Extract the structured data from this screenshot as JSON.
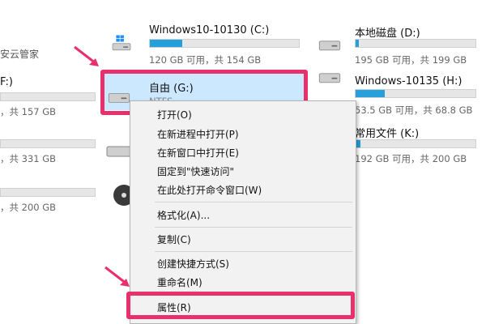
{
  "colors": {
    "accent": "#e8306c",
    "usage_bar": "#26a0da"
  },
  "top_left_label": "安云管家",
  "drives": [
    {
      "id": "c",
      "name": "Windows10-10130 (C:)",
      "space": "120 GB 可用，共 154 GB",
      "used_fraction": 0.22,
      "icon": "windows-drive-icon"
    },
    {
      "id": "d",
      "name": "本地磁盘 (D:)",
      "space": "195 GB 可用，共 199 GB",
      "used_fraction": 0.03,
      "icon": "hard-drive-icon"
    },
    {
      "id": "g",
      "name": "自由 (G:)",
      "space": "NTFS",
      "icon": "hard-drive-icon"
    },
    {
      "id": "h",
      "name": "Windows-10135 (H:)",
      "space": "53.5 GB 可用，共 68.8 GB",
      "used_fraction": 0.24,
      "icon": "hard-drive-icon"
    },
    {
      "id": "k",
      "name": "常用文件 (K:)",
      "space": "192 GB 可用，共 200 GB",
      "used_fraction": 0.04,
      "icon": "hard-drive-icon"
    }
  ],
  "left_partial": [
    {
      "name": "F:)",
      "space": "共 157 GB"
    },
    {
      "space": "共 331 GB"
    },
    {
      "space": "共 200 GB"
    }
  ],
  "context_menu": {
    "items": [
      {
        "id": "open",
        "label": "打开(O)"
      },
      {
        "id": "open-new-process",
        "label": "在新进程中打开(P)"
      },
      {
        "id": "open-new-window",
        "label": "在新窗口中打开(E)"
      },
      {
        "id": "pin-quick-access",
        "label": "固定到\"快速访问\""
      },
      {
        "id": "open-cmd-here",
        "label": "在此处打开命令窗口(W)"
      },
      {
        "id": "format",
        "label": "格式化(A)..."
      },
      {
        "id": "copy",
        "label": "复制(C)"
      },
      {
        "id": "create-shortcut",
        "label": "创建快捷方式(S)"
      },
      {
        "id": "rename",
        "label": "重命名(M)"
      },
      {
        "id": "properties",
        "label": "属性(R)"
      }
    ]
  }
}
